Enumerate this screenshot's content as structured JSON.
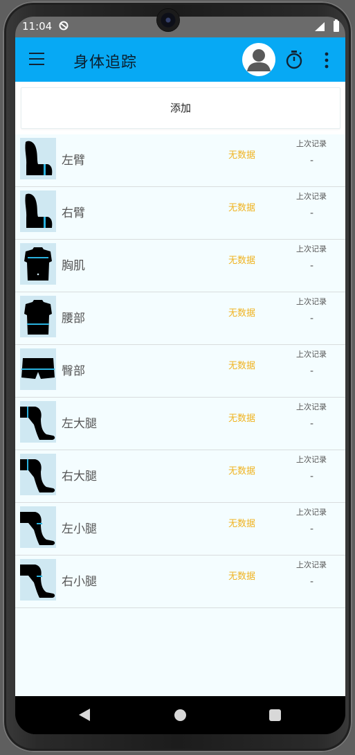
{
  "status": {
    "time": "11:04"
  },
  "toolbar": {
    "title": "身体追踪",
    "bg": "#07a9f4"
  },
  "add_button": "添加",
  "rows": [
    {
      "name": "左臂",
      "status": "无数据",
      "last_label": "上次记录",
      "last_value": "-",
      "icon": "left-arm-icon"
    },
    {
      "name": "右臂",
      "status": "无数据",
      "last_label": "上次记录",
      "last_value": "-",
      "icon": "right-arm-icon"
    },
    {
      "name": "胸肌",
      "status": "无数据",
      "last_label": "上次记录",
      "last_value": "-",
      "icon": "chest-icon"
    },
    {
      "name": "腰部",
      "status": "无数据",
      "last_label": "上次记录",
      "last_value": "-",
      "icon": "waist-icon"
    },
    {
      "name": "臀部",
      "status": "无数据",
      "last_label": "上次记录",
      "last_value": "-",
      "icon": "hips-icon"
    },
    {
      "name": "左大腿",
      "status": "无数据",
      "last_label": "上次记录",
      "last_value": "-",
      "icon": "left-thigh-icon"
    },
    {
      "name": "右大腿",
      "status": "无数据",
      "last_label": "上次记录",
      "last_value": "-",
      "icon": "right-thigh-icon"
    },
    {
      "name": "左小腿",
      "status": "无数据",
      "last_label": "上次记录",
      "last_value": "-",
      "icon": "left-calf-icon"
    },
    {
      "name": "右小腿",
      "status": "无数据",
      "last_label": "上次记录",
      "last_value": "-",
      "icon": "right-calf-icon"
    }
  ],
  "colors": {
    "accent": "#07a9f4",
    "nodata": "#f0b320",
    "icon_bg": "#cfe8f2",
    "list_bg": "#f4fdff"
  }
}
